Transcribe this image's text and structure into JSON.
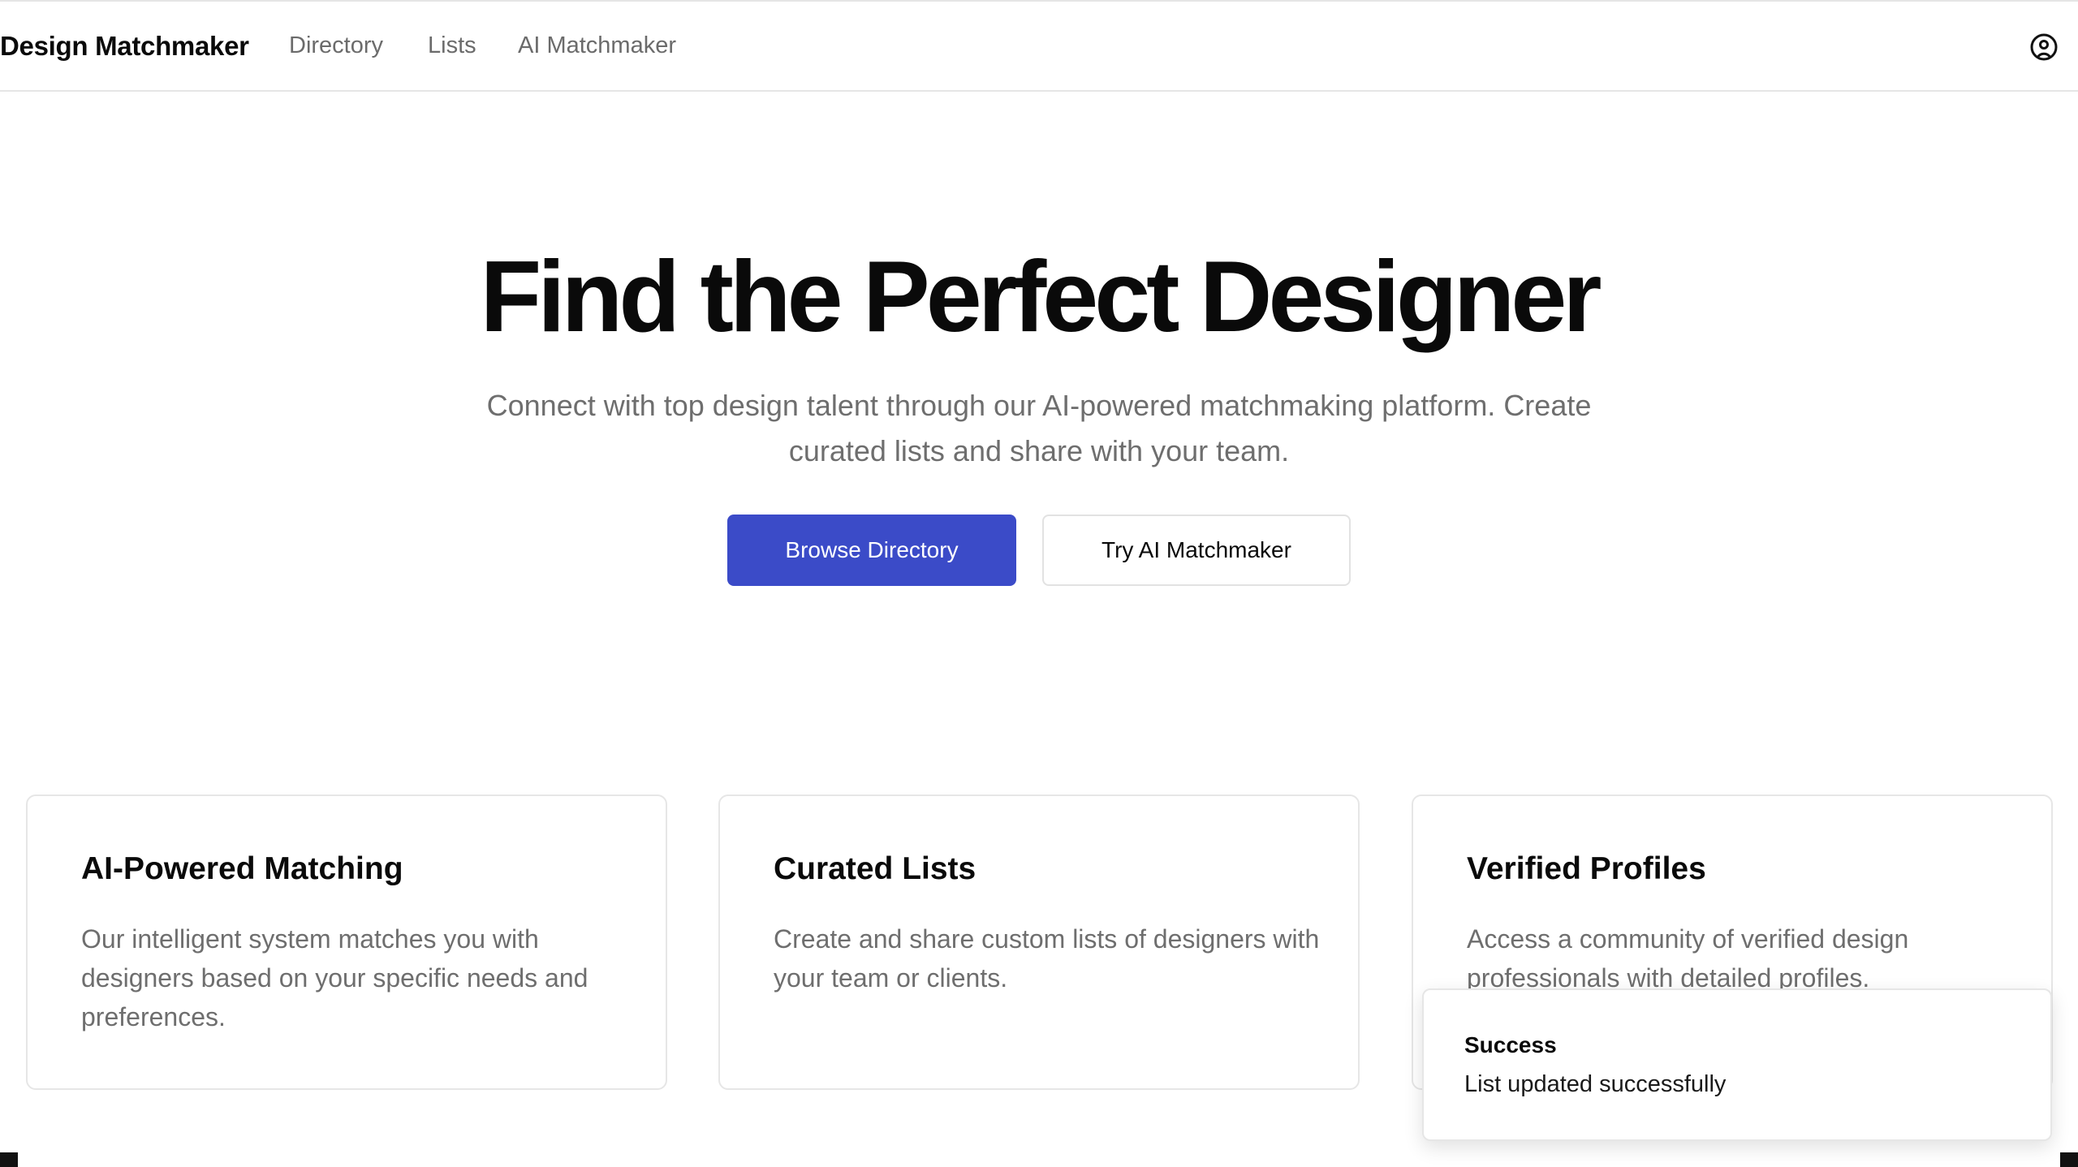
{
  "header": {
    "brand": "Design Matchmaker",
    "nav": [
      {
        "label": "Directory"
      },
      {
        "label": "Lists"
      },
      {
        "label": "AI Matchmaker"
      }
    ],
    "user_icon": "user-circle-icon"
  },
  "hero": {
    "title": "Find the Perfect Designer",
    "subtitle": "Connect with top design talent through our AI-powered matchmaking platform. Create curated lists and share with your team.",
    "primary_button": "Browse Directory",
    "secondary_button": "Try AI Matchmaker"
  },
  "features": [
    {
      "title": "AI-Powered Matching",
      "body": "Our intelligent system matches you with designers based on your specific needs and preferences."
    },
    {
      "title": "Curated Lists",
      "body": "Create and share custom lists of designers with your team or clients."
    },
    {
      "title": "Verified Profiles",
      "body": "Access a community of verified design professionals with detailed profiles."
    }
  ],
  "toast": {
    "title": "Success",
    "message": "List updated successfully"
  },
  "colors": {
    "primary": "#3b4bc8",
    "text": "#0a0a0a",
    "muted": "#6e6e6e",
    "border": "#e6e6e6"
  }
}
